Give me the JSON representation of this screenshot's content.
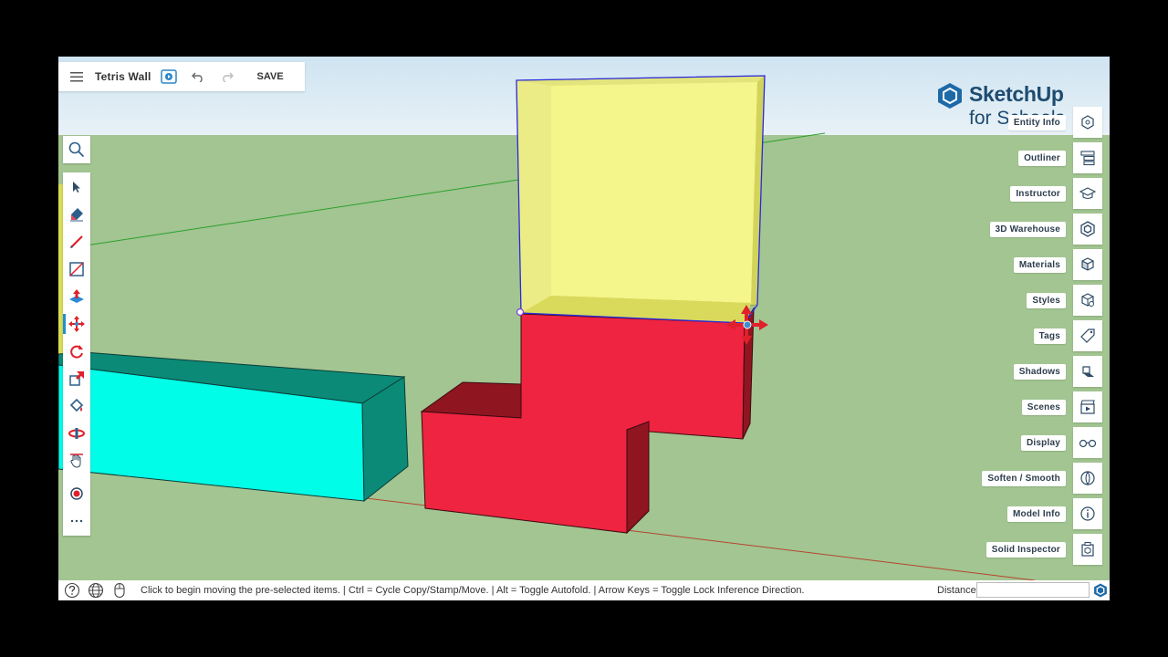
{
  "topbar": {
    "menu_icon": "hamburger-menu-icon",
    "model_title": "Tetris Wall",
    "save_label": "SAVE"
  },
  "brand": {
    "name": "SketchUp",
    "sub": "for Schools"
  },
  "left_toolbar": {
    "tools": [
      {
        "name": "search",
        "icon": "search-icon"
      },
      {
        "name": "select",
        "icon": "select-arrow-icon"
      },
      {
        "name": "eraser",
        "icon": "eraser-icon"
      },
      {
        "name": "pencil",
        "icon": "pencil-icon"
      },
      {
        "name": "rectangle",
        "icon": "rectangle-icon"
      },
      {
        "name": "push-pull",
        "icon": "push-pull-icon"
      },
      {
        "name": "move",
        "icon": "move-icon",
        "active": true
      },
      {
        "name": "rotate",
        "icon": "rotate-icon"
      },
      {
        "name": "scale",
        "icon": "scale-icon"
      },
      {
        "name": "paint-bucket",
        "icon": "paint-bucket-icon"
      },
      {
        "name": "orbit",
        "icon": "orbit-icon"
      },
      {
        "name": "pan",
        "icon": "pan-hand-icon"
      },
      {
        "name": "walkthrough",
        "icon": "position-camera-icon"
      },
      {
        "name": "more",
        "icon": "more-dots-icon"
      }
    ]
  },
  "right_panels": [
    {
      "label": "Entity Info",
      "icon": "entity-info-icon"
    },
    {
      "label": "Outliner",
      "icon": "outliner-icon"
    },
    {
      "label": "Instructor",
      "icon": "instructor-icon"
    },
    {
      "label": "3D Warehouse",
      "icon": "warehouse-icon"
    },
    {
      "label": "Materials",
      "icon": "materials-icon"
    },
    {
      "label": "Styles",
      "icon": "styles-icon"
    },
    {
      "label": "Tags",
      "icon": "tags-icon"
    },
    {
      "label": "Shadows",
      "icon": "shadows-icon"
    },
    {
      "label": "Scenes",
      "icon": "scenes-icon"
    },
    {
      "label": "Display",
      "icon": "display-glasses-icon"
    },
    {
      "label": "Soften / Smooth",
      "icon": "soften-smooth-icon"
    },
    {
      "label": "Model Info",
      "icon": "model-info-icon"
    },
    {
      "label": "Solid Inspector",
      "icon": "solid-inspector-icon"
    }
  ],
  "statusbar": {
    "text": "Click to begin moving the pre-selected items. | Ctrl = Cycle Copy/Stamp/Move. | Alt = Toggle Autofold. | Arrow Keys = Toggle Lock Inference Direction.",
    "distance_label": "Distance",
    "distance_value": "",
    "help_icon": "help-icon",
    "globe_icon": "globe-icon",
    "mouse_icon": "mouse-icon"
  },
  "colors": {
    "sky": "#d9e9f3",
    "ground": "#a2c591",
    "cyan_block": "#00fde8",
    "teal_top": "#0b8a78",
    "red_block": "#ee2440",
    "red_dark": "#8f1521",
    "yellow_selected": "#f4f58a",
    "selection_blue": "#2a2adf",
    "move_cursor_red": "#e0202a",
    "brand_blue": "#1e4b70"
  }
}
